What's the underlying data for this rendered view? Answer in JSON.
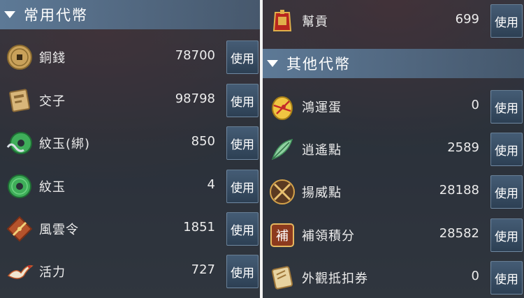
{
  "left_panel": {
    "section_title": "常用代幣",
    "items": [
      {
        "name": "銅錢",
        "count": "78700",
        "icon": "copper-coin-icon",
        "use_label": "使用"
      },
      {
        "name": "交子",
        "count": "98798",
        "icon": "paper-note-icon",
        "use_label": "使用"
      },
      {
        "name": "紋玉(綁)",
        "count": "850",
        "icon": "bound-jade-icon",
        "use_label": "使用"
      },
      {
        "name": "紋玉",
        "count": "4",
        "icon": "jade-icon",
        "use_label": "使用"
      },
      {
        "name": "風雲令",
        "count": "1851",
        "icon": "token-icon",
        "use_label": "使用"
      },
      {
        "name": "活力",
        "count": "727",
        "icon": "crane-icon",
        "use_label": "使用"
      }
    ]
  },
  "right_panel": {
    "top_item": {
      "name": "幫貢",
      "count": "699",
      "icon": "guild-contribution-icon",
      "use_label": "使用"
    },
    "section_title": "其他代幣",
    "items": [
      {
        "name": "鴻運蛋",
        "count": "0",
        "icon": "lucky-egg-icon",
        "use_label": "使用"
      },
      {
        "name": "逍遙點",
        "count": "2589",
        "icon": "leaf-icon",
        "use_label": "使用"
      },
      {
        "name": "揚威點",
        "count": "28188",
        "icon": "crossed-weapons-icon",
        "use_label": "使用"
      },
      {
        "name": "補領積分",
        "count": "28582",
        "icon": "supplement-badge-icon",
        "use_label": "使用",
        "badge_char": "補"
      },
      {
        "name": "外觀抵扣券",
        "count": "0",
        "icon": "coupon-scroll-icon",
        "use_label": "使用"
      }
    ]
  }
}
